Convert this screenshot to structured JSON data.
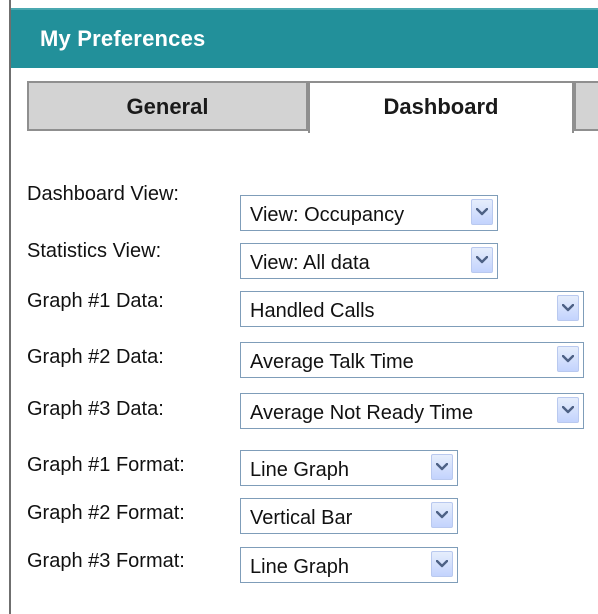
{
  "header": {
    "title": "My Preferences"
  },
  "tabs": [
    {
      "label": "General",
      "selected": false
    },
    {
      "label": "Dashboard",
      "selected": true
    },
    {
      "label": "",
      "selected": false
    }
  ],
  "form": {
    "rows": [
      {
        "label": "Dashboard View:",
        "value": "View: Occupancy"
      },
      {
        "label": "Statistics View:",
        "value": "View: All data"
      },
      {
        "label": "Graph #1 Data:",
        "value": "Handled Calls"
      },
      {
        "label": "Graph #2 Data:",
        "value": "Average Talk Time"
      },
      {
        "label": "Graph #3 Data:",
        "value": "Average Not Ready Time"
      },
      {
        "label": "Graph #1 Format:",
        "value": "Line Graph"
      },
      {
        "label": "Graph #2 Format:",
        "value": "Vertical Bar"
      },
      {
        "label": "Graph #3 Format:",
        "value": "Line Graph"
      }
    ]
  },
  "icons": {
    "dropdown": "chevron-down-icon"
  },
  "colors": {
    "header_background": "#22909a",
    "header_text": "#ffffff",
    "tab_inactive": "#d3d3d3",
    "tab_active": "#ffffff",
    "dropdown_arrow": "#4d6185"
  }
}
